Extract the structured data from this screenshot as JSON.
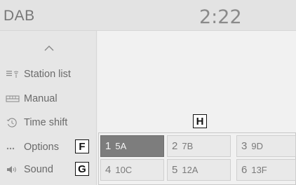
{
  "header": {
    "source": "DAB",
    "time": "2:22"
  },
  "menu": {
    "items": [
      {
        "label": "Station list",
        "icon": "station-list-icon"
      },
      {
        "label": "Manual",
        "icon": "manual-tuning-icon"
      },
      {
        "label": "Time shift",
        "icon": "time-shift-icon"
      },
      {
        "label": "Options",
        "icon": "options-icon"
      },
      {
        "label": "Sound",
        "icon": "speaker-icon"
      }
    ]
  },
  "callouts": {
    "options": "F",
    "sound": "G",
    "presets": "H"
  },
  "presets": [
    {
      "num": "1",
      "station": "5A",
      "selected": true
    },
    {
      "num": "2",
      "station": "7B",
      "selected": false
    },
    {
      "num": "3",
      "station": "9D",
      "selected": false
    },
    {
      "num": "4",
      "station": "10C",
      "selected": false
    },
    {
      "num": "5",
      "station": "12A",
      "selected": false
    },
    {
      "num": "6",
      "station": "13F",
      "selected": false
    }
  ]
}
